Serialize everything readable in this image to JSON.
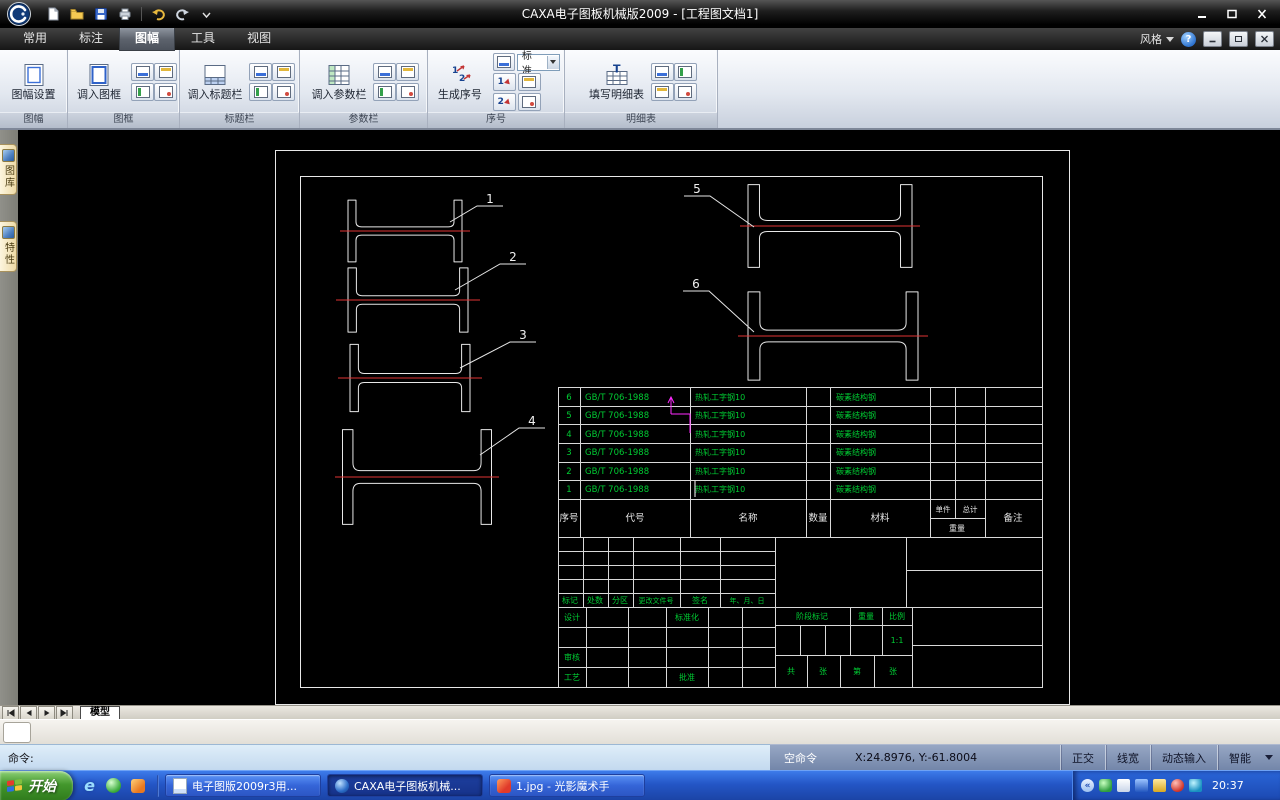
{
  "window": {
    "title": "CAXA电子图板机械版2009 - [工程图文档1]"
  },
  "tabs": {
    "items": [
      "常用",
      "标注",
      "图幅",
      "工具",
      "视图"
    ],
    "active": "图幅"
  },
  "ribbon": {
    "style_label": "风格",
    "help_glyph": "?",
    "panels": [
      {
        "label": "图幅",
        "big": "图幅设置"
      },
      {
        "label": "图框",
        "big": "调入图框"
      },
      {
        "label": "标题栏",
        "big": "调入标题栏"
      },
      {
        "label": "参数栏",
        "big": "调入参数栏"
      },
      {
        "label": "序号",
        "big": "生成序号",
        "combo": "标准",
        "icon_digits": [
          "1",
          "2"
        ]
      },
      {
        "label": "明细表",
        "big": "填写明细表",
        "icon_letter": "T"
      }
    ]
  },
  "side_panel": {
    "tabs": [
      "图库",
      "特性"
    ]
  },
  "drawing": {
    "balloons": [
      "1",
      "2",
      "3",
      "4",
      "5",
      "6"
    ],
    "bom": {
      "headers": {
        "seq": "序号",
        "code": "代号",
        "name": "名称",
        "qty": "数量",
        "material": "材料",
        "unit": "单件",
        "total": "总计",
        "weight": "重量",
        "remark": "备注"
      },
      "rows": [
        {
          "seq": "6",
          "code": "GB/T 706-1988",
          "name": "热轧工字钢10",
          "material": "碳素结构钢"
        },
        {
          "seq": "5",
          "code": "GB/T 706-1988",
          "name": "热轧工字钢10",
          "material": "碳素结构钢"
        },
        {
          "seq": "4",
          "code": "GB/T 706-1988",
          "name": "热轧工字钢10",
          "material": "碳素结构钢"
        },
        {
          "seq": "3",
          "code": "GB/T 706-1988",
          "name": "热轧工字钢10",
          "material": "碳素结构钢"
        },
        {
          "seq": "2",
          "code": "GB/T 706-1988",
          "name": "热轧工字钢10",
          "material": "碳素结构钢"
        },
        {
          "seq": "1",
          "code": "GB/T 706-1988",
          "name": "热轧工字钢10",
          "material": "碳素结构钢"
        }
      ]
    },
    "titleblock": {
      "mark": "标记",
      "count": "处数",
      "zone": "分区",
      "change_no": "更改文件号",
      "sign": "签名",
      "date": "年、月、日",
      "design": "设计",
      "standard": "标准化",
      "audit": "审核",
      "process": "工艺",
      "approve": "批准",
      "stage": "阶段标记",
      "weight": "重量",
      "scale_label": "比例",
      "scale_value": "1:1",
      "total_label": "共",
      "sheet_label": "张",
      "page_label": "第",
      "sheet_label2": "张"
    }
  },
  "model_bar": {
    "tab": "模型"
  },
  "command": {
    "prompt": "命令:"
  },
  "status": {
    "mode": "空命令",
    "coords": "X:24.8976, Y:-61.8004",
    "toggles": [
      "正交",
      "线宽",
      "动态输入",
      "智能"
    ]
  },
  "taskbar": {
    "start": "开始",
    "ie_glyph": "e",
    "tray_chevron": "«",
    "tasks": [
      {
        "label": "电子图版2009r3用..."
      },
      {
        "label": "CAXA电子图板机械..."
      },
      {
        "label": "1.jpg - 光影魔术手"
      }
    ],
    "time": "20:37"
  }
}
